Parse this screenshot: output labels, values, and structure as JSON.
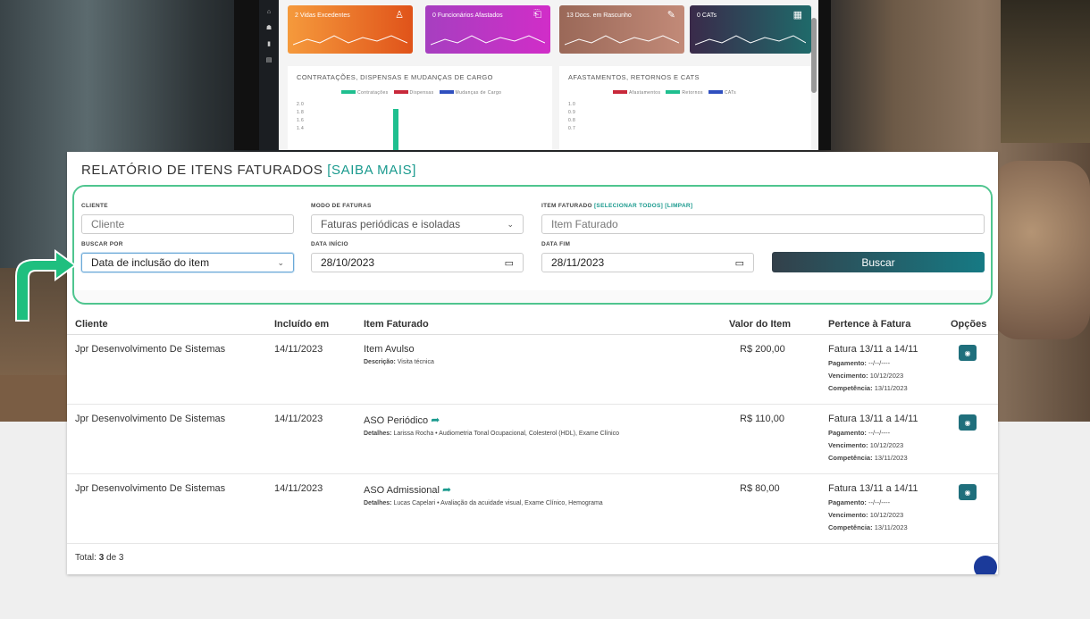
{
  "dashboard": {
    "cards": [
      {
        "label": "2  Vidas Excedentes",
        "icon": "user-icon",
        "color1": "#f59a3c",
        "color2": "#e0531a"
      },
      {
        "label": "0  Funcionários Afastados",
        "icon": "exit-icon",
        "color1": "#a63fc0",
        "color2": "#d12dc8"
      },
      {
        "label": "13  Docs. em Rascunho",
        "icon": "edit-icon",
        "color1": "#9a6858",
        "color2": "#c28a78"
      },
      {
        "label": "0  CATs",
        "icon": "book-icon",
        "color1": "#3a2a4a",
        "color2": "#1f6a6a"
      }
    ],
    "panel_left": {
      "title": "CONTRATAÇÕES, DISPENSAS E MUDANÇAS DE CARGO",
      "legend": [
        "Contratações",
        "Dispensas",
        "Mudanças de Cargo"
      ],
      "ticks": [
        "2.0",
        "1.8",
        "1.6",
        "1.4"
      ]
    },
    "panel_right": {
      "title": "AFASTAMENTOS, RETORNOS E CATS",
      "legend": [
        "Afastamentos",
        "Retornos",
        "CATs"
      ],
      "ticks": [
        "1.0",
        "0.9",
        "0.8",
        "0.7"
      ]
    }
  },
  "report": {
    "title": "RELATÓRIO DE ITENS FATURADOS",
    "title_link": "[SAIBA MAIS]",
    "filters": {
      "cliente_label": "CLIENTE",
      "cliente_placeholder": "Cliente",
      "modo_label": "MODO DE FATURAS",
      "modo_value": "Faturas periódicas e isoladas",
      "item_label": "ITEM FATURADO",
      "item_link_all": "[SELECIONAR TODOS]",
      "item_link_clear": "[LIMPAR]",
      "item_placeholder": "Item Faturado",
      "buscar_por_label": "BUSCAR POR",
      "buscar_por_value": "Data de inclusão do item",
      "data_inicio_label": "DATA INÍCIO",
      "data_inicio_value": "28/10/2023",
      "data_fim_label": "DATA FIM",
      "data_fim_value": "28/11/2023",
      "buscar_button": "Buscar"
    },
    "table": {
      "headers": {
        "cliente": "Cliente",
        "incluido": "Incluído em",
        "item": "Item Faturado",
        "valor": "Valor do Item",
        "fatura": "Pertence à Fatura",
        "opcoes": "Opções"
      },
      "rows": [
        {
          "cliente": "Jpr Desenvolvimento De Sistemas",
          "incluido": "14/11/2023",
          "item": "Item Avulso",
          "detail_label": "Descrição:",
          "detail": "Visita técnica",
          "valor": "R$ 200,00",
          "fatura": "Fatura 13/11 a 14/11",
          "pagamento_label": "Pagamento:",
          "pagamento": "--/--/----",
          "vencimento_label": "Vencimento:",
          "vencimento": "10/12/2023",
          "competencia_label": "Competência:",
          "competencia": "13/11/2023"
        },
        {
          "cliente": "Jpr Desenvolvimento De Sistemas",
          "incluido": "14/11/2023",
          "item": "ASO Periódico",
          "detail_label": "Detalhes:",
          "detail": "Larissa Rocha • Audiometria Tonal Ocupacional, Colesterol (HDL), Exame Clínico",
          "valor": "R$ 110,00",
          "fatura": "Fatura 13/11 a 14/11",
          "pagamento_label": "Pagamento:",
          "pagamento": "--/--/----",
          "vencimento_label": "Vencimento:",
          "vencimento": "10/12/2023",
          "competencia_label": "Competência:",
          "competencia": "13/11/2023"
        },
        {
          "cliente": "Jpr Desenvolvimento De Sistemas",
          "incluido": "14/11/2023",
          "item": "ASO Admissional",
          "detail_label": "Detalhes:",
          "detail": "Lucas Capelari • Avaliação da acuidade visual, Exame Clínico, Hemograma",
          "valor": "R$ 80,00",
          "fatura": "Fatura 13/11 a 14/11",
          "pagamento_label": "Pagamento:",
          "pagamento": "--/--/----",
          "vencimento_label": "Vencimento:",
          "vencimento": "10/12/2023",
          "competencia_label": "Competência:",
          "competencia": "13/11/2023"
        }
      ]
    },
    "total_prefix": "Total:",
    "total_count": "3",
    "total_suffix": "de 3"
  },
  "colors": {
    "accent": "#1a9a8e",
    "highlight_border": "#4fc58f",
    "eye_button": "#1f6f7c"
  }
}
